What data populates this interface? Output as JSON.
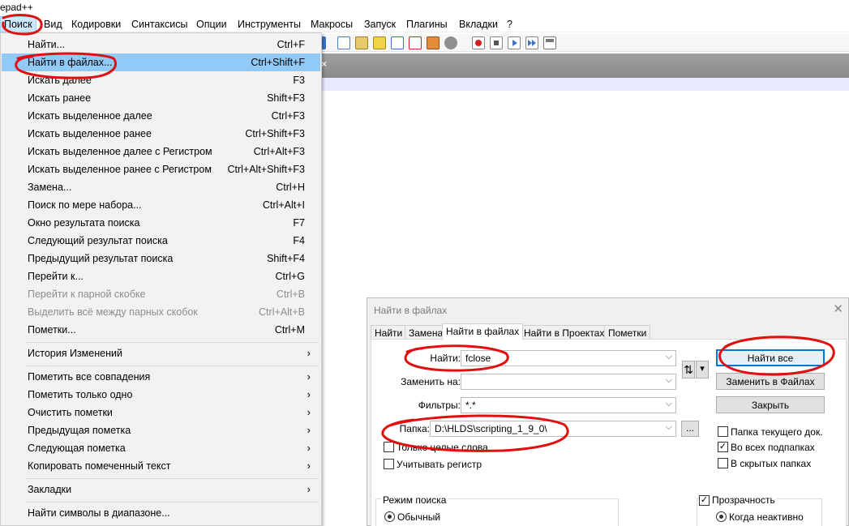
{
  "window": {
    "title_fragment": "epad++"
  },
  "menubar": {
    "items": [
      "Поиск",
      "Вид",
      "Кодировки",
      "Синтаксисы",
      "Опции",
      "Инструменты",
      "Макросы",
      "Запуск",
      "Плагины",
      "Вкладки",
      "?"
    ]
  },
  "tab_close": "×",
  "search_menu": {
    "items": [
      {
        "label": "Найти...",
        "shortcut": "Ctrl+F"
      },
      {
        "label": "Найти в файлах...",
        "shortcut": "Ctrl+Shift+F"
      },
      {
        "label": "Искать далее",
        "shortcut": "F3"
      },
      {
        "label": "Искать ранее",
        "shortcut": "Shift+F3"
      },
      {
        "label": "Искать выделенное далее",
        "shortcut": "Ctrl+F3"
      },
      {
        "label": "Искать выделенное ранее",
        "shortcut": "Ctrl+Shift+F3"
      },
      {
        "label": "Искать выделенное далее с Регистром",
        "shortcut": "Ctrl+Alt+F3"
      },
      {
        "label": "Искать выделенное ранее с Регистром",
        "shortcut": "Ctrl+Alt+Shift+F3"
      },
      {
        "label": "Замена...",
        "shortcut": "Ctrl+H"
      },
      {
        "label": "Поиск по мере набора...",
        "shortcut": "Ctrl+Alt+I"
      },
      {
        "label": "Окно результата поиска",
        "shortcut": "F7"
      },
      {
        "label": "Следующий результат поиска",
        "shortcut": "F4"
      },
      {
        "label": "Предыдущий результат поиска",
        "shortcut": "Shift+F4"
      },
      {
        "label": "Перейти к...",
        "shortcut": "Ctrl+G"
      },
      {
        "label": "Перейти к парной скобке",
        "shortcut": "Ctrl+B"
      },
      {
        "label": "Выделить всё между парных скобок",
        "shortcut": "Ctrl+Alt+B"
      },
      {
        "label": "Пометки...",
        "shortcut": "Ctrl+M"
      },
      {
        "label": "История Изменений",
        "shortcut": ""
      },
      {
        "label": "Пометить все совпадения",
        "shortcut": ""
      },
      {
        "label": "Пометить только одно",
        "shortcut": ""
      },
      {
        "label": "Очистить пометки",
        "shortcut": ""
      },
      {
        "label": "Предыдущая пометка",
        "shortcut": ""
      },
      {
        "label": "Следующая пометка",
        "shortcut": ""
      },
      {
        "label": "Копировать помеченный текст",
        "shortcut": ""
      },
      {
        "label": "Закладки",
        "shortcut": ""
      },
      {
        "label": "Найти символы в диапазоне...",
        "shortcut": ""
      }
    ],
    "submenu_arrow": "›"
  },
  "dialog": {
    "title": "Найти в файлах",
    "close": "✕",
    "tabs": [
      "Найти",
      "Замена",
      "Найти в файлах",
      "Найти в Проектах",
      "Пометки"
    ],
    "find_label": "Найти:",
    "find_value": "fclose",
    "replace_label": "Заменить на:",
    "replace_value": "",
    "filters_label": "Фильтры:",
    "filters_value": "*.*",
    "folder_label": "Папка:",
    "folder_value": "D:\\HLDS\\scripting_1_9_0\\",
    "browse": "...",
    "swap": "⇅",
    "swap_dd": "▾",
    "combo_dd": "⌵",
    "whole_words": "Только целые слова",
    "match_case": "Учитывать регистр",
    "btn_find_all": "Найти все",
    "btn_replace_files": "Заменить в Файлах",
    "btn_close": "Закрыть",
    "cur_doc_folder": "Папка текущего док.",
    "subfolders": "Во всех подпапках",
    "hidden_folders": "В скрытых папках",
    "check_mark": "✓",
    "search_mode": "Режим поиска",
    "mode_normal": "Обычный",
    "transparency": "Прозрачность",
    "when_inactive": "Когда неактивно"
  },
  "colors": {
    "menu_bg": "#f2f2f2",
    "menu_highlight": "#91c9f7",
    "menubar_active": "#cce8ff",
    "default_button_border": "#0078d7",
    "annotation_red": "#e01010"
  },
  "state": {
    "subfolders_checked": true,
    "transparency_checked": true
  }
}
